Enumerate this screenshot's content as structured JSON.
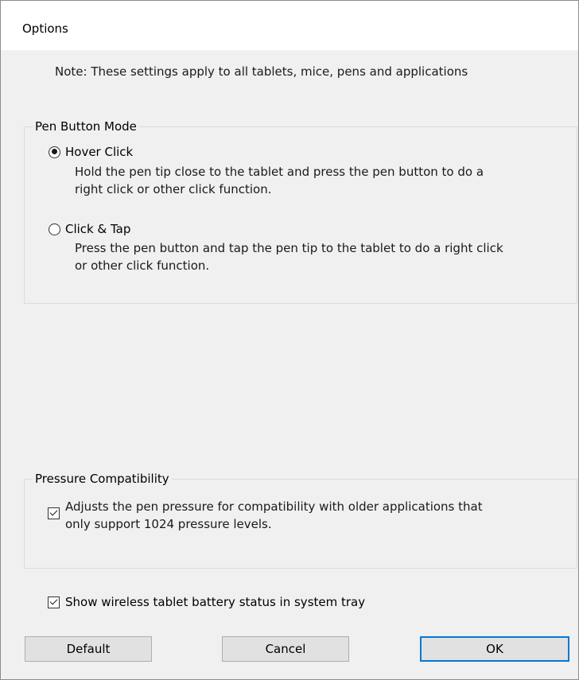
{
  "window": {
    "title": "Options"
  },
  "note": "Note: These settings apply to all tablets, mice, pens and applications",
  "pen_button_mode": {
    "legend": "Pen Button Mode",
    "options": [
      {
        "label": "Hover Click",
        "selected": true,
        "description_line1": "Hold the pen tip close to the tablet and press the pen button to do a",
        "description_line2": "right click or other click function."
      },
      {
        "label": "Click & Tap",
        "selected": false,
        "description_line1": "Press the pen button and tap the pen tip to the tablet to do a right click",
        "description_line2": "or other click function."
      }
    ]
  },
  "pressure_compatibility": {
    "legend": "Pressure Compatibility",
    "checkbox": {
      "checked": true,
      "label_line1": "Adjusts the pen pressure for compatibility with older applications that",
      "label_line2": "only support 1024 pressure levels."
    }
  },
  "battery_status": {
    "checked": true,
    "label": "Show wireless tablet battery status in system tray"
  },
  "buttons": {
    "default": "Default",
    "cancel": "Cancel",
    "ok": "OK"
  }
}
